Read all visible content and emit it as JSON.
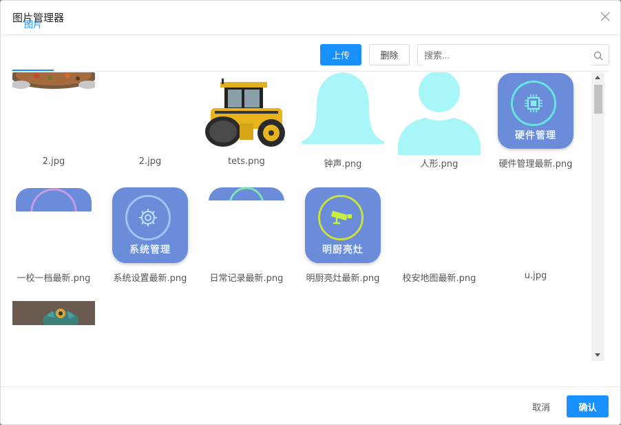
{
  "dialog": {
    "title": "图片管理器",
    "tab": "图片"
  },
  "toolbar": {
    "upload_label": "上传",
    "delete_label": "删除",
    "search_placeholder": "搜索..."
  },
  "images": [
    {
      "name": "2.jpg"
    },
    {
      "name": "2.jpg"
    },
    {
      "name": "tets.png"
    },
    {
      "name": "钟声.png"
    },
    {
      "name": "人形.png"
    },
    {
      "name": "硬件管理最新.png",
      "icon_text": "硬件管理"
    },
    {
      "name": "一校一档最新.png"
    },
    {
      "name": "系统设置最新.png",
      "icon_text": "系统管理"
    },
    {
      "name": "日常记录最新.png"
    },
    {
      "name": "明厨亮灶最新.png",
      "icon_text": "明厨亮灶"
    },
    {
      "name": "校安地图最新.png"
    },
    {
      "name": "u.jpg"
    }
  ],
  "footer": {
    "cancel_label": "取消",
    "confirm_label": "确认"
  },
  "colors": {
    "primary": "#1890ff",
    "icon_bg": "#6a8cd9",
    "silhouette": "#a8f6f7"
  }
}
